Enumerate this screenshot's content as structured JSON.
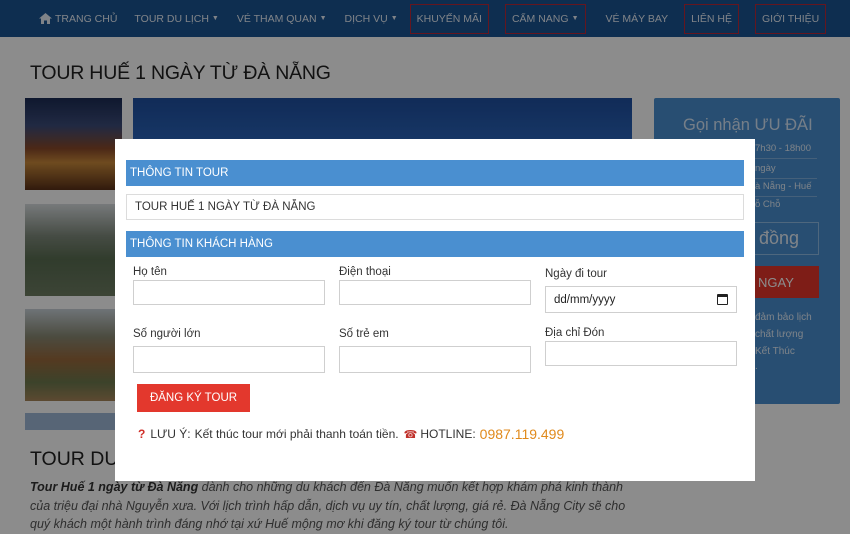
{
  "nav": {
    "home": "TRANG CHỦ",
    "items": [
      {
        "label": "TOUR DU LỊCH",
        "dropdown": true
      },
      {
        "label": "VÉ THAM QUAN",
        "dropdown": true
      },
      {
        "label": "DỊCH VỤ",
        "dropdown": true
      },
      {
        "label": "KHUYẾN MÃI",
        "dropdown": false
      },
      {
        "label": "CẨM NANG",
        "dropdown": true
      },
      {
        "label": "VÉ MÁY BAY",
        "dropdown": false
      },
      {
        "label": "LIÊN HỆ",
        "dropdown": false
      },
      {
        "label": "GIỚI THIỆU",
        "dropdown": false
      }
    ]
  },
  "page": {
    "title": "TOUR HUẾ 1 NGÀY TỪ ĐÀ NẴNG",
    "section_title": "TOUR DU L",
    "desc_bold": "Tour Huế 1 ngày từ Đà Nẵng",
    "desc_rest": " dành cho những du khách đến Đà Nẵng muốn kết hợp khám phá kinh thành của triệu đại nhà Nguyễn xưa. Với lịch trình hấp dẫn, dịch vụ uy tín, chất lượng, giá rẻ. Đà Nẵng City sẽ cho quý khách một hành trình đáng nhớ tại xứ Huế mộng mơ khi đăng ký tour từ chúng tôi."
  },
  "sidebar": {
    "title": "Gọi nhận ƯU ĐÃI",
    "lines": [
      "7h30 - 18h00",
      "ngày",
      "à Nẵng - Huế",
      "ỗ Chỗ"
    ],
    "price": "đồng",
    "book": "NGAY",
    "notes": [
      "đảm bảo lịch",
      "chất lượng",
      "Kết Thúc",
      "."
    ]
  },
  "modal": {
    "tour_header": "THÔNG TIN TOUR",
    "tour_name": "TOUR HUẾ 1 NGÀY TỪ ĐÀ NẴNG",
    "customer_header": "THÔNG TIN KHÁCH HÀNG",
    "fields": {
      "name": "Họ tên",
      "phone": "Điện thoại",
      "date": "Ngày đi tour",
      "adults": "Số người lớn",
      "children": "Số trẻ em",
      "pickup": "Địa chỉ Đón"
    },
    "date_placeholder": "dd/mm/yyyy",
    "submit": "ĐĂNG KÝ TOUR",
    "note_mark": "?",
    "note_label": "LƯU Ý:",
    "note_text": "Kết thúc tour mới phải thanh toán tiền.",
    "hotline_label": "HOTLINE:",
    "hotline_number": "0987.119.499"
  },
  "icons": {
    "home": "home-icon",
    "caret": "chevron-down-icon",
    "calendar": "calendar-icon",
    "question": "question-icon",
    "phone": "phone-icon"
  },
  "colors": {
    "nav_bg": "#1a5592",
    "section_header": "#4a8fd0",
    "button": "#e3382d",
    "hotline": "#e08a1c"
  }
}
